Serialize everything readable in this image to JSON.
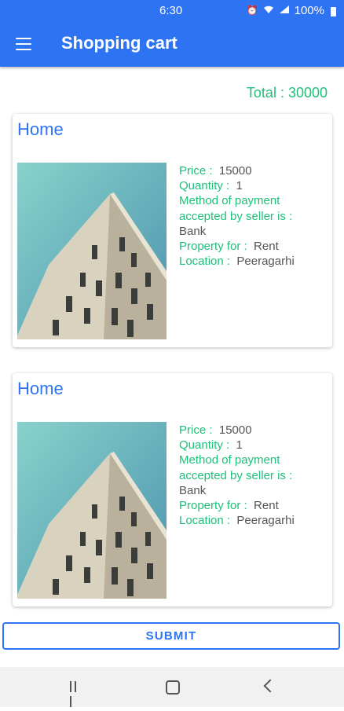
{
  "status_bar": {
    "time": "6:30",
    "battery": "100%",
    "icons": [
      "alarm-icon",
      "wifi-icon",
      "signal-icon",
      "battery-icon"
    ]
  },
  "app_bar": {
    "title": "Shopping cart",
    "menu_icon": "menu-icon",
    "color": "#2e73f2"
  },
  "cart": {
    "total_text": "Total : 30000",
    "items": [
      {
        "title": "Home",
        "price_label": "Price :",
        "price": "15000",
        "quantity_label": "Quantity :",
        "quantity": "1",
        "payment_label": "Method of payment accepted by seller is :",
        "payment": "Bank",
        "property_label": "Property for :",
        "property": "Rent",
        "location_label": "Location :",
        "location": "Peeragarhi"
      },
      {
        "title": "Home",
        "price_label": "Price :",
        "price": "15000",
        "quantity_label": "Quantity :",
        "quantity": "1",
        "payment_label": "Method of payment accepted by seller is :",
        "payment": "Bank",
        "property_label": "Property for :",
        "property": "Rent",
        "location_label": "Location :",
        "location": "Peeragarhi"
      }
    ]
  },
  "submit_label": "SUBMIT",
  "nav_bar": {
    "icons": [
      "recent-apps-icon",
      "home-icon",
      "back-icon"
    ]
  },
  "colors": {
    "accent": "#2e73f2",
    "label_green": "#1ec07a",
    "value_gray": "#555555"
  }
}
